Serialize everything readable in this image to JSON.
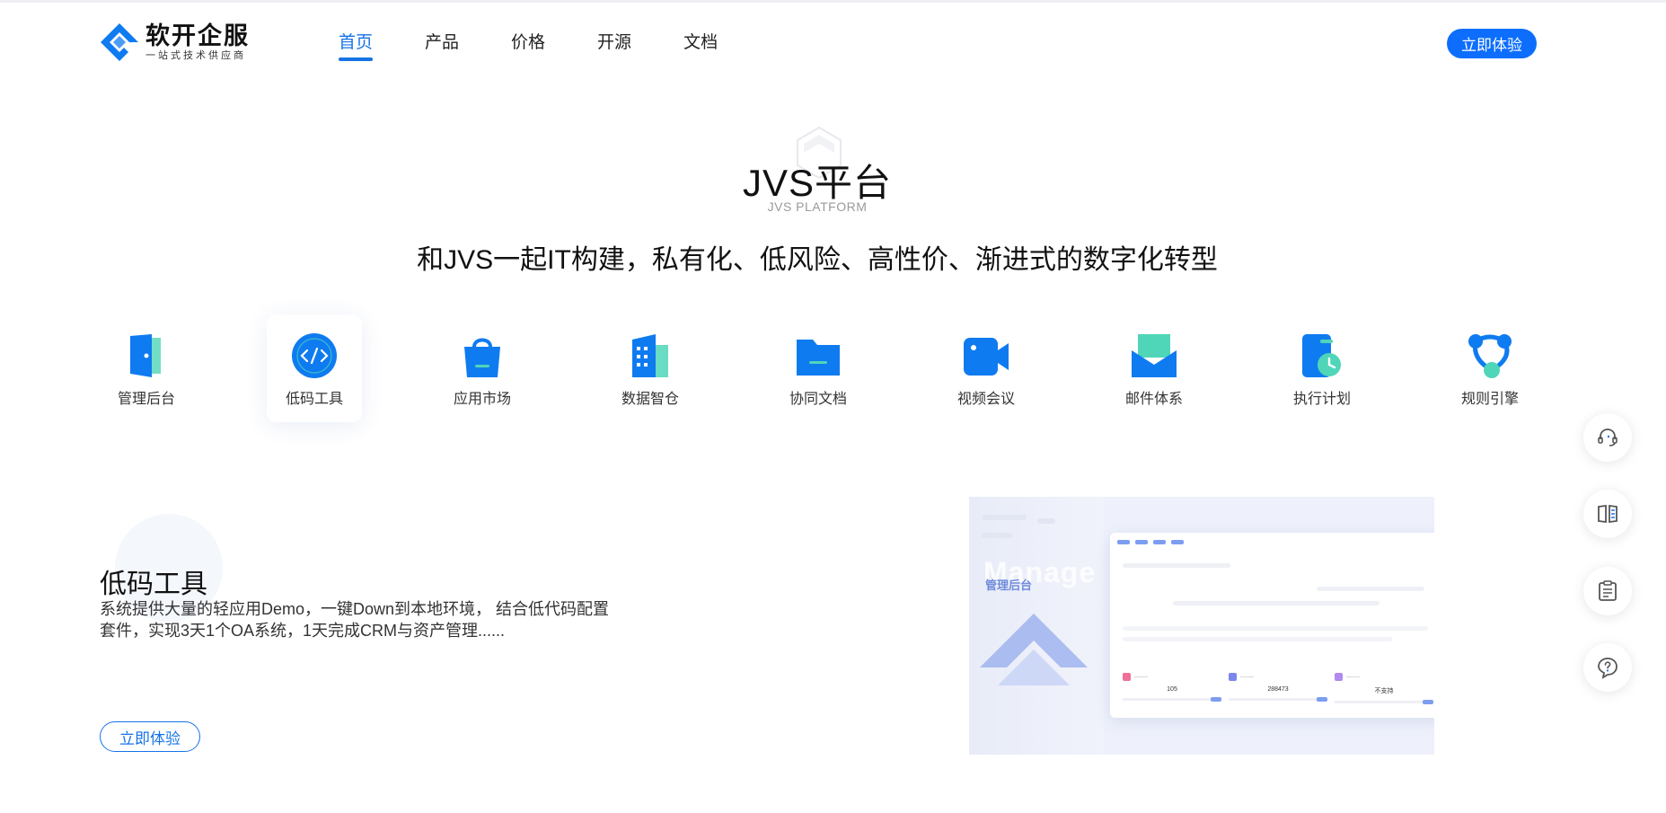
{
  "header": {
    "logo_title": "软开企服",
    "logo_subtitle": "一站式技术供应商",
    "nav": [
      {
        "label": "首页",
        "active": true
      },
      {
        "label": "产品"
      },
      {
        "label": "价格"
      },
      {
        "label": "开源"
      },
      {
        "label": "文档"
      }
    ],
    "cta_label": "立即体验"
  },
  "hero": {
    "title": "JVS平台",
    "subtitle": "JVS PLATFORM",
    "slogan": "和JVS一起IT构建，私有化、低风险、高性价、渐进式的数字化转型"
  },
  "features": [
    {
      "label": "管理后台",
      "icon": "door-icon"
    },
    {
      "label": "低码工具",
      "icon": "code-icon",
      "active": true
    },
    {
      "label": "应用市场",
      "icon": "shopping-bag-icon"
    },
    {
      "label": "数据智仓",
      "icon": "building-icon"
    },
    {
      "label": "协同文档",
      "icon": "folder-icon"
    },
    {
      "label": "视频会议",
      "icon": "video-camera-icon"
    },
    {
      "label": "邮件体系",
      "icon": "mail-icon"
    },
    {
      "label": "执行计划",
      "icon": "clock-plan-icon"
    },
    {
      "label": "规则引擎",
      "icon": "rule-network-icon"
    }
  ],
  "side_buttons": [
    "headset-icon",
    "book-icon",
    "clipboard-icon",
    "help-icon"
  ],
  "detail": {
    "title": "低码工具",
    "description": "系统提供大量的轻应用Demo，一键Down到本地环境， 结合低代码配置套件，实现3天1个OA系统，1天完成CRM与资产管理......",
    "button_label": "立即体验"
  },
  "preview": {
    "label": "管理后台",
    "watermark": "Manage",
    "stats": [
      {
        "value": "105",
        "color": "#f06f96"
      },
      {
        "value": "288473",
        "color": "#7b86f0"
      },
      {
        "value": "不支持",
        "color": "#b08af0"
      }
    ]
  },
  "colors": {
    "accent": "#1673e6",
    "button": "#0d6efd",
    "icon_blue": "#0f7bf0",
    "icon_teal": "#4fd6b8"
  }
}
